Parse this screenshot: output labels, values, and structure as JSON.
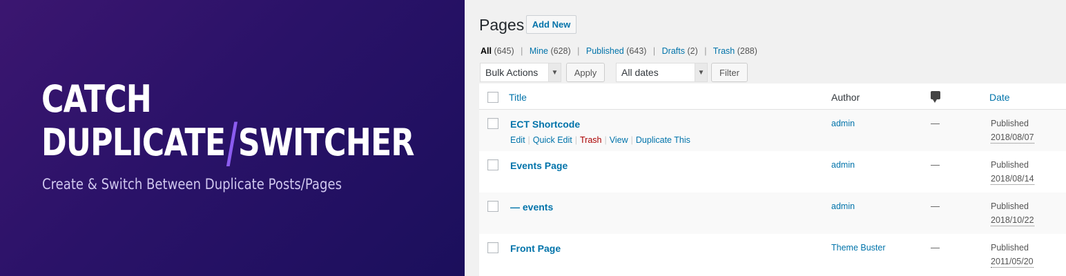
{
  "banner": {
    "title_line1": "CATCH",
    "title_line2_a": "DUPLICATE",
    "title_slash": "/",
    "title_line2_b": "SWITCHER",
    "subtitle": "Create & Switch Between Duplicate Posts/Pages"
  },
  "admin": {
    "heading": "Pages",
    "add_new": "Add New",
    "filters": {
      "all": "All",
      "all_count": "(645)",
      "mine": "Mine",
      "mine_count": "(628)",
      "published": "Published",
      "published_count": "(643)",
      "drafts": "Drafts",
      "drafts_count": "(2)",
      "trash": "Trash",
      "trash_count": "(288)",
      "separator": "|"
    },
    "bulk_actions": "Bulk Actions",
    "apply": "Apply",
    "all_dates": "All dates",
    "filter": "Filter",
    "columns": {
      "title": "Title",
      "author": "Author",
      "date": "Date"
    },
    "comment_icon": "comment-bubble-icon",
    "row_actions": {
      "edit": "Edit",
      "quick_edit": "Quick Edit",
      "trash": "Trash",
      "view": "View",
      "duplicate": "Duplicate This",
      "separator": "|"
    },
    "rows": [
      {
        "title": "ECT Shortcode",
        "author": "admin",
        "comments": "—",
        "status": "Published",
        "date": "2018/08/07"
      },
      {
        "title": "Events Page",
        "author": "admin",
        "comments": "—",
        "status": "Published",
        "date": "2018/08/14"
      },
      {
        "title": "— events",
        "author": "admin",
        "comments": "—",
        "status": "Published",
        "date": "2018/10/22"
      },
      {
        "title": "Front Page",
        "author": "Theme Buster",
        "comments": "—",
        "status": "Published",
        "date": "2011/05/20"
      }
    ]
  }
}
